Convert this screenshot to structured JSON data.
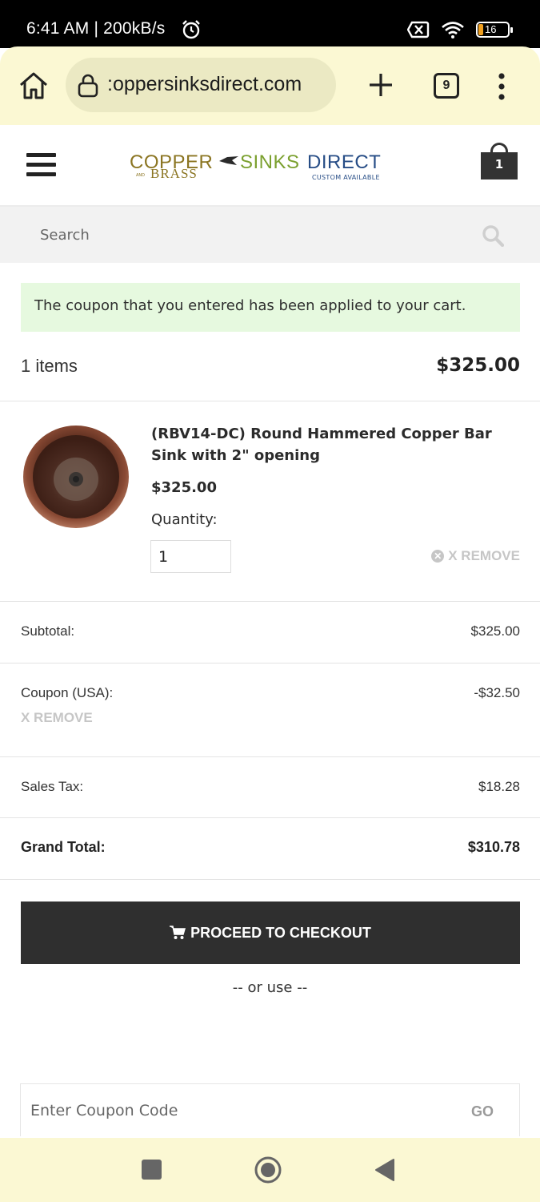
{
  "status_bar": {
    "time": "6:41 AM | 200kB/s",
    "battery": "16"
  },
  "browser": {
    "url": ":oppersinksdirect.com",
    "tab_count": "9"
  },
  "site": {
    "logo": {
      "copper": "COPPER",
      "and": "AND",
      "brass": "BRASS",
      "sinks": "SINKS",
      "direct": "DIRECT",
      "custom": "CUSTOM AVAILABLE"
    },
    "cart_count": "1",
    "search_placeholder": "Search"
  },
  "cart": {
    "alert": "The coupon that you entered has been applied to your cart.",
    "items_count": "1 items",
    "items_total": "$325.00",
    "item": {
      "name": "(RBV14-DC) Round Hammered Copper Bar Sink with 2\" opening",
      "price": "$325.00",
      "quantity_label": "Quantity:",
      "quantity": "1",
      "remove_label": "X REMOVE"
    },
    "subtotal_label": "Subtotal:",
    "subtotal": "$325.00",
    "coupon_label": "Coupon (USA):",
    "coupon_value": "-$32.50",
    "coupon_remove": "X REMOVE",
    "tax_label": "Sales Tax:",
    "tax": "$18.28",
    "grand_total_label": "Grand Total:",
    "grand_total": "$310.78",
    "checkout_label": "PROCEED TO CHECKOUT",
    "or_use": "-- or use --",
    "coupon_placeholder": "Enter Coupon Code",
    "coupon_go": "GO"
  },
  "colors": {
    "browser_chrome": "#fbf8d3",
    "alert_bg": "#e6f9df",
    "checkout_bg": "#2f2f2f"
  }
}
